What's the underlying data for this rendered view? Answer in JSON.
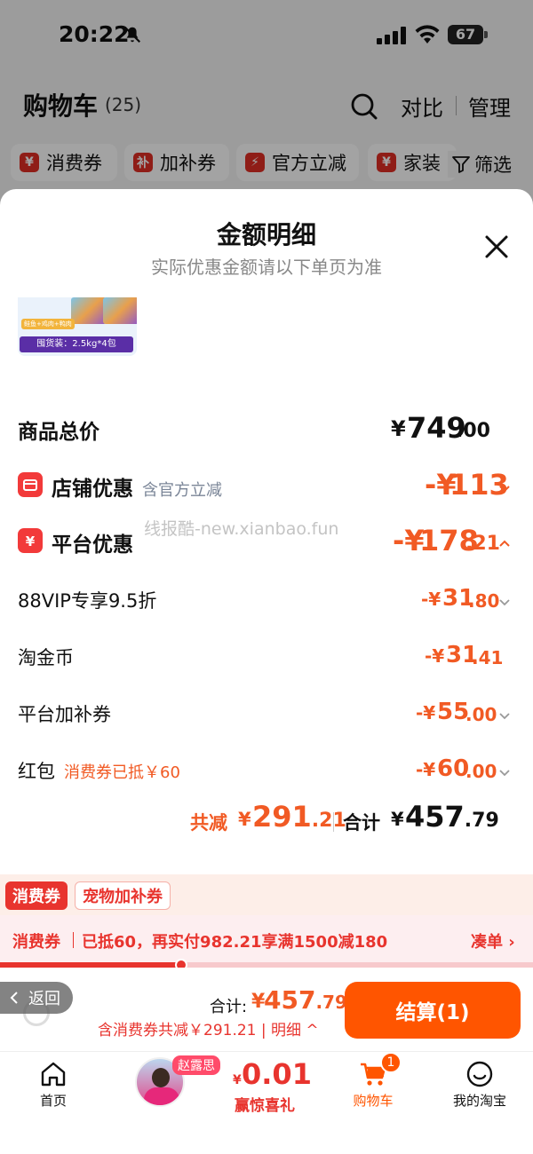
{
  "status_bar": {
    "time": "20:22",
    "battery": "67",
    "icons": [
      "mute-icon",
      "signal-icon",
      "wifi-icon",
      "battery-icon"
    ]
  },
  "header": {
    "title": "购物车",
    "count": "(25)",
    "compare": "对比",
    "manage": "管理",
    "search_icon": "search-icon"
  },
  "filter_chips": [
    {
      "icon_text": "¥",
      "label": "消费券"
    },
    {
      "icon_text": "补",
      "label": "加补券"
    },
    {
      "icon_text": "⚡",
      "label": "官方立减"
    },
    {
      "icon_text": "¥",
      "label": "家装"
    }
  ],
  "filter_button": "筛选",
  "sheet": {
    "title": "金额明细",
    "subtitle": "实际优惠金额请以下单页为准",
    "product_image": {
      "tag_text": "鲑鱼+鸡肉+鸭肉",
      "label": "囤货装：2.5kg*4包"
    },
    "total_price": {
      "label": "商品总价",
      "currency": "¥",
      "integer": "749",
      "decimal": ".00"
    },
    "store_discount": {
      "label": "店铺优惠",
      "note": "含官方立减",
      "prefix": "-¥",
      "integer": "113",
      "decimal": ""
    },
    "platform_discount": {
      "label": "平台优惠",
      "prefix": "-¥",
      "integer": "178",
      "decimal": ".21"
    },
    "items": [
      {
        "label": "88VIP专享9.5折",
        "prefix": "-¥",
        "integer": "31",
        "decimal": ".80",
        "chevron": true
      },
      {
        "label": "淘金币",
        "prefix": "-¥",
        "integer": "31",
        "decimal": ".41",
        "chevron": false
      },
      {
        "label": "平台加补券",
        "prefix": "-¥",
        "integer": "55",
        "decimal": ".00",
        "chevron": true
      },
      {
        "label": "红包",
        "note": "消费券已抵￥60",
        "prefix": "-¥",
        "integer": "60",
        "decimal": ".00",
        "chevron": true
      }
    ],
    "summary": {
      "saved_label": "共减",
      "saved_currency": "¥",
      "saved_integer": "291",
      "saved_decimal": ".21",
      "total_label": "合计",
      "total_currency": "¥",
      "total_integer": "457",
      "total_decimal": ".79"
    },
    "watermark": "线报酷-new.xianbao.fun"
  },
  "coupon_tabs": {
    "active": "消费券",
    "other": "宠物加补券"
  },
  "coupon_bar": {
    "label": "消费券",
    "text": "已抵60，再实付982.21享满1500减180",
    "link": "凑单 ›",
    "progress": 0.34
  },
  "checkout": {
    "back": "返回",
    "total_label": "合计:",
    "currency": "¥",
    "integer": "457",
    "decimal": ".79",
    "sub": "含消费券共减￥291.21 | 明细 ^",
    "button": "结算(1)"
  },
  "tabbar": {
    "home": "首页",
    "promo_name": "赵露思",
    "promo_currency": "¥",
    "promo_price": "0.01",
    "promo_text": "赢惊喜礼",
    "cart": "购物车",
    "cart_badge": "1",
    "mine": "我的淘宝"
  },
  "colors": {
    "accent": "#f15a24",
    "brand_red": "#e8342e",
    "checkout_orange": "#ff5500"
  }
}
